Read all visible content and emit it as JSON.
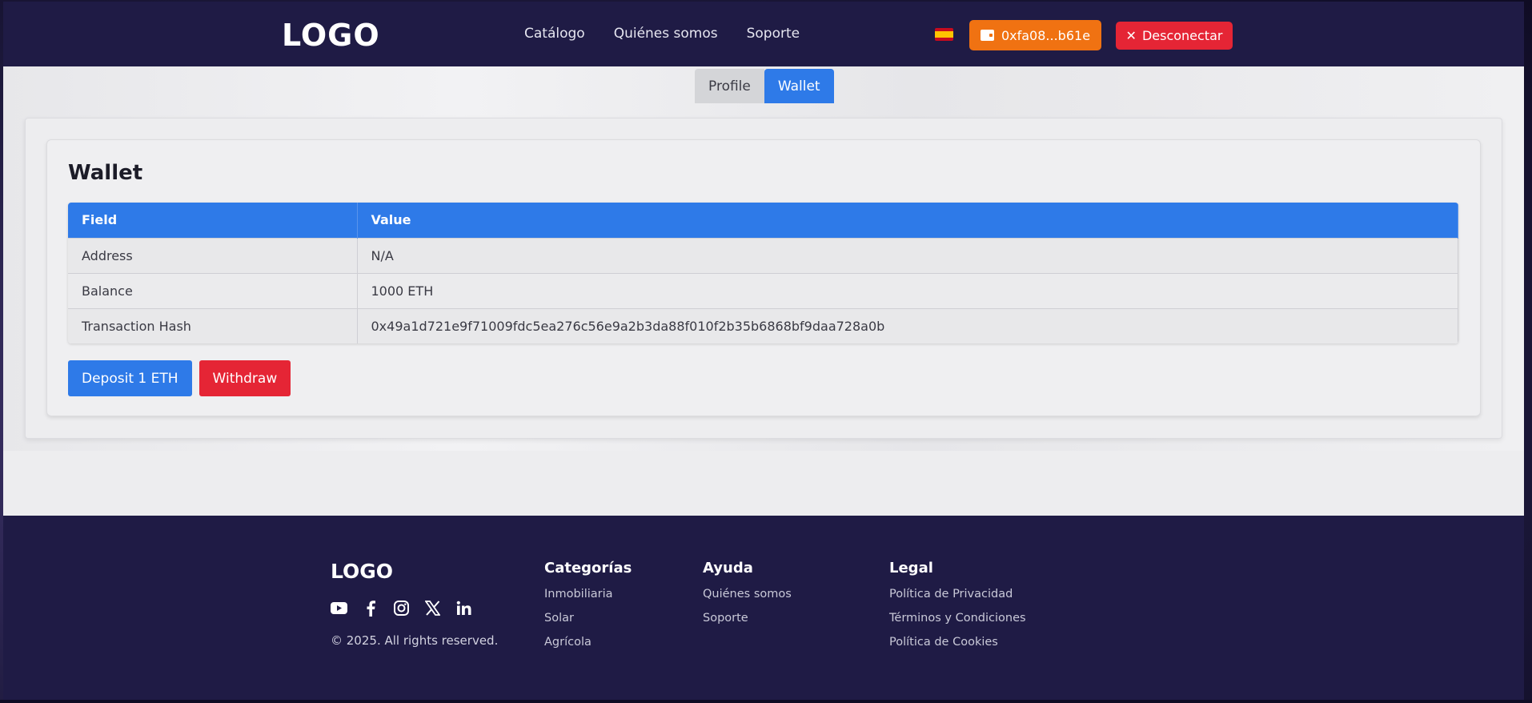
{
  "header": {
    "logo": "LOGO",
    "nav": [
      "Catálogo",
      "Quiénes somos",
      "Soporte"
    ],
    "language_flag": "spain-flag-icon",
    "wallet_button": "0xfa08...b61e",
    "disconnect_button": "Desconectar"
  },
  "tabs": [
    {
      "label": "Profile",
      "active": false
    },
    {
      "label": "Wallet",
      "active": true
    }
  ],
  "wallet": {
    "title": "Wallet",
    "columns": [
      "Field",
      "Value"
    ],
    "rows": [
      {
        "field": "Address",
        "value": "N/A"
      },
      {
        "field": "Balance",
        "value": "1000 ETH"
      },
      {
        "field": "Transaction Hash",
        "value": "0x49a1d721e9f71009fdc5ea276c56e9a2b3da88f010f2b35b6868bf9daa728a0b"
      }
    ],
    "deposit_button": "Deposit 1 ETH",
    "withdraw_button": "Withdraw"
  },
  "footer": {
    "logo": "LOGO",
    "socials": [
      "youtube-icon",
      "facebook-icon",
      "instagram-icon",
      "x-icon",
      "linkedin-icon"
    ],
    "copyright": "© 2025. All rights reserved.",
    "categories": {
      "title": "Categorías",
      "links": [
        "Inmobiliaria",
        "Solar",
        "Agrícola"
      ]
    },
    "help": {
      "title": "Ayuda",
      "links": [
        "Quiénes somos",
        "Soporte"
      ]
    },
    "legal": {
      "title": "Legal",
      "links": [
        "Política de Privacidad",
        "Términos y Condiciones",
        "Política de Cookies"
      ]
    }
  },
  "colors": {
    "navy": "#1f1b45",
    "primary_blue": "#2e7ae8",
    "orange": "#f07212",
    "red": "#e52535"
  }
}
